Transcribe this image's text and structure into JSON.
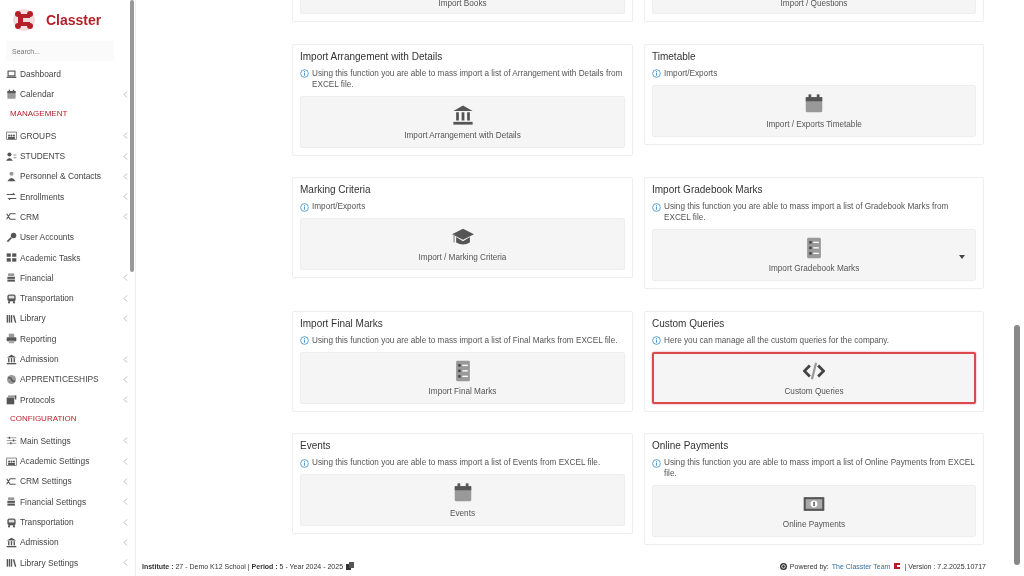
{
  "brand": {
    "name": "Classter"
  },
  "search": {
    "placeholder": "Search..."
  },
  "sidebar": {
    "items": [
      {
        "kind": "laptop",
        "label": "Dashboard",
        "has_submenu": false
      },
      {
        "kind": "calendar",
        "label": "Calendar",
        "has_submenu": true
      },
      {
        "kind": "heading",
        "label": "MANAGEMENT"
      },
      {
        "kind": "people",
        "label": "GROUPS",
        "has_submenu": true
      },
      {
        "kind": "students",
        "label": "STUDENTS",
        "has_submenu": true
      },
      {
        "kind": "person",
        "label": "Personnel & Contacts",
        "has_submenu": true
      },
      {
        "kind": "arrows",
        "label": "Enrollments",
        "has_submenu": true
      },
      {
        "kind": "shuffle",
        "label": "CRM",
        "has_submenu": true
      },
      {
        "kind": "key",
        "label": "User Accounts",
        "has_submenu": false
      },
      {
        "kind": "grid",
        "label": "Academic Tasks",
        "has_submenu": false
      },
      {
        "kind": "stack",
        "label": "Financial",
        "has_submenu": true
      },
      {
        "kind": "bus",
        "label": "Transportation",
        "has_submenu": true
      },
      {
        "kind": "books",
        "label": "Library",
        "has_submenu": true
      },
      {
        "kind": "printer",
        "label": "Reporting",
        "has_submenu": false
      },
      {
        "kind": "bank",
        "label": "Admission",
        "has_submenu": true
      },
      {
        "kind": "globe",
        "label": "APPRENTICESHIPS",
        "has_submenu": true
      },
      {
        "kind": "folder",
        "label": "Protocols",
        "has_submenu": true
      },
      {
        "kind": "heading",
        "label": "CONFIGURATION"
      },
      {
        "kind": "sliders",
        "label": "Main Settings",
        "has_submenu": true
      },
      {
        "kind": "people",
        "label": "Academic Settings",
        "has_submenu": true
      },
      {
        "kind": "shuffle",
        "label": "CRM Settings",
        "has_submenu": true
      },
      {
        "kind": "stack",
        "label": "Financial Settings",
        "has_submenu": true
      },
      {
        "kind": "bus",
        "label": "Transportation",
        "has_submenu": true
      },
      {
        "kind": "bank",
        "label": "Admission",
        "has_submenu": true
      },
      {
        "kind": "books",
        "label": "Library Settings",
        "has_submenu": true
      }
    ]
  },
  "cards": [
    {
      "tile": {
        "label": "Import Books",
        "selected": false,
        "has_dropdown": false
      }
    },
    {
      "tile": {
        "label": "Import / Questions",
        "selected": false,
        "has_dropdown": false
      }
    },
    {
      "title": "Import Arrangement with Details",
      "description": "Using this function you are able to mass import a list of Arrangement with Details from EXCEL file.",
      "tile": {
        "label": "Import Arrangement with Details",
        "kind": "bank",
        "selected": false,
        "has_dropdown": false
      }
    },
    {
      "title": "Timetable",
      "description": "Import/Exports",
      "tile": {
        "label": "Import / Exports Timetable",
        "kind": "calendar",
        "selected": false,
        "has_dropdown": false
      }
    },
    {
      "title": "Marking Criteria",
      "description": "Import/Exports",
      "tile": {
        "label": "Import / Marking Criteria",
        "kind": "graduation",
        "selected": false,
        "has_dropdown": false
      }
    },
    {
      "title": "Import Gradebook Marks",
      "description": "Using this function you are able to mass import a list of Gradebook Marks from EXCEL file.",
      "tile": {
        "label": "Import Gradebook Marks",
        "kind": "list",
        "selected": false,
        "has_dropdown": true
      }
    },
    {
      "title": "Import Final Marks",
      "description": "Using this function you are able to mass import a list of Final Marks from EXCEL file.",
      "tile": {
        "label": "Import Final Marks",
        "kind": "checklist",
        "selected": false,
        "has_dropdown": false
      }
    },
    {
      "title": "Custom Queries",
      "description": "Here you can manage all the custom queries for the company.",
      "tile": {
        "label": "Custom Queries",
        "kind": "code",
        "selected": true,
        "has_dropdown": false
      }
    },
    {
      "title": "Events",
      "description": "Using this function you are able to mass import a list of Events from EXCEL file.",
      "tile": {
        "label": "Events",
        "kind": "event",
        "selected": false,
        "has_dropdown": false
      }
    },
    {
      "title": "Online Payments",
      "description": "Using this function you are able to mass import a list of Online Payments from EXCEL file.",
      "tile": {
        "label": "Online Payments",
        "kind": "money",
        "selected": false,
        "has_dropdown": false
      }
    }
  ],
  "footer": {
    "info": "**Institute :** 27 - Demo K12 School | **Period :** 5 - Year 2024 - 2025",
    "powered": "Powered by:",
    "link": "The Classter Team",
    "version": "| Version : 7.2.2025.10717"
  }
}
